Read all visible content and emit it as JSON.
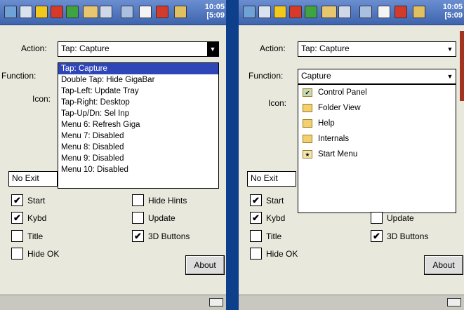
{
  "status_clock": {
    "time": "10:05",
    "sub": "[5:09"
  },
  "left": {
    "action_label": "Action:",
    "action_value": "Tap: Capture",
    "function_label": "Function:",
    "icon_label": "Icon:",
    "dropdown_items": [
      "Tap: Capture",
      "Double Tap: Hide GigaBar",
      "Tap-Left: Update Tray",
      "Tap-Right: Desktop",
      "Tap-Up/Dn: Sel Inp",
      "Menu 6: Refresh Giga",
      "Menu 7: Disabled",
      "Menu 8: Disabled",
      "Menu 9: Disabled",
      "Menu 10: Disabled"
    ],
    "exit_value": "No Exit",
    "checkboxes": {
      "start": {
        "label": "Start",
        "checked": true
      },
      "kybd": {
        "label": "Kybd",
        "checked": true
      },
      "title": {
        "label": "Title",
        "checked": false
      },
      "hide_ok": {
        "label": "Hide OK",
        "checked": false
      },
      "hide_hints": {
        "label": "Hide Hints",
        "checked": false
      },
      "update": {
        "label": "Update",
        "checked": false
      },
      "buttons_3d": {
        "label": "3D Buttons",
        "checked": true
      }
    },
    "about_label": "About"
  },
  "right": {
    "action_label": "Action:",
    "action_value": "Tap: Capture",
    "function_label": "Function:",
    "function_value": "Capture",
    "icon_label": "Icon:",
    "folder_items": [
      {
        "label": "Control Panel",
        "icon": "control-panel-icon"
      },
      {
        "label": "Folder View",
        "icon": "folder-icon"
      },
      {
        "label": "Help",
        "icon": "folder-icon"
      },
      {
        "label": "Internals",
        "icon": "folder-icon"
      },
      {
        "label": "Start Menu",
        "icon": "start-menu-icon"
      }
    ],
    "exit_value": "No Exit",
    "checkboxes": {
      "start": {
        "label": "Start",
        "checked": true
      },
      "kybd": {
        "label": "Kybd",
        "checked": true
      },
      "title": {
        "label": "Title",
        "checked": false
      },
      "hide_ok": {
        "label": "Hide OK",
        "checked": false
      },
      "update": {
        "label": "Update",
        "checked": false
      },
      "buttons_3d": {
        "label": "3D Buttons",
        "checked": true
      }
    },
    "about_label": "About"
  },
  "colors": {
    "frame": "#0d3f8a",
    "selection": "#2f46b8",
    "panel": "#e8e8dc"
  }
}
